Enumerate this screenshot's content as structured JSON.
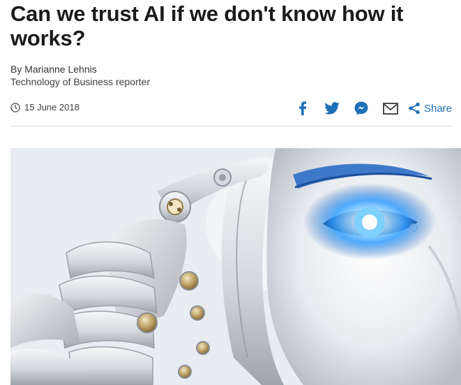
{
  "article": {
    "headline": "Can we trust AI if we don't know how it works?",
    "author": "By Marianne Lehnis",
    "author_role": "Technology of Business reporter",
    "date": "15 June 2018"
  },
  "share": {
    "label": "Share",
    "icons": [
      "facebook-icon",
      "twitter-icon",
      "messenger-icon",
      "email-icon",
      "share-icon"
    ],
    "accent": "#1d70b8"
  },
  "hero_image": {
    "subject": "robot-hand-touching-robot-head-with-glowing-blue-eye"
  }
}
